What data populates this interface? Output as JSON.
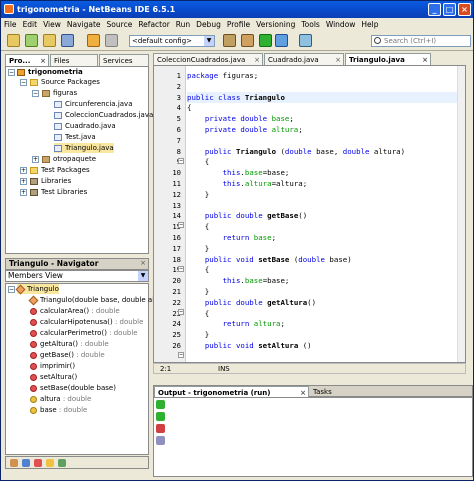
{
  "window": {
    "title": "trigonometria - NetBeans IDE 6.5.1"
  },
  "menu": [
    "File",
    "Edit",
    "View",
    "Navigate",
    "Source",
    "Refactor",
    "Run",
    "Debug",
    "Profile",
    "Versioning",
    "Tools",
    "Window",
    "Help"
  ],
  "toolbar": {
    "config": "<default config>",
    "search_placeholder": "Search (Ctrl+I)"
  },
  "left_tabs": [
    "Pro...",
    "Files",
    "Services"
  ],
  "tree": {
    "project": "trigonometria",
    "source_packages": "Source Packages",
    "package": "figuras",
    "files": [
      "Circunferencia.java",
      "ColeccionCuadrados.java",
      "Cuadrado.java",
      "Test.java",
      "Triangulo.java"
    ],
    "other_package": "otropaquete",
    "test_packages": "Test Packages",
    "libraries": "Libraries",
    "test_libraries": "Test Libraries"
  },
  "navigator": {
    "title": "Triangulo - Navigator",
    "view": "Members View",
    "root": "Triangulo",
    "members": [
      {
        "name": "Triangulo(double base, double altura)",
        "type": "",
        "kind": "constructor"
      },
      {
        "name": "calcularArea()",
        "type": " : double",
        "kind": "method"
      },
      {
        "name": "calcularHipotenusa()",
        "type": " : double",
        "kind": "method"
      },
      {
        "name": "calcularPerimetro()",
        "type": " : double",
        "kind": "method"
      },
      {
        "name": "getAltura()",
        "type": " : double",
        "kind": "method"
      },
      {
        "name": "getBase()",
        "type": " : double",
        "kind": "method"
      },
      {
        "name": "imprimir()",
        "type": "",
        "kind": "method"
      },
      {
        "name": "setAltura()",
        "type": "",
        "kind": "method"
      },
      {
        "name": "setBase(double base)",
        "type": "",
        "kind": "method"
      },
      {
        "name": "altura",
        "type": " : double",
        "kind": "field"
      },
      {
        "name": "base",
        "type": " : double",
        "kind": "field"
      }
    ]
  },
  "editor_tabs": [
    "ColeccionCuadrados.java",
    "Cuadrado.java",
    "Triangulo.java"
  ],
  "code_lines": [
    {
      "n": "1",
      "html": "<span class='kw'>package</span> figuras;"
    },
    {
      "n": "2",
      "html": ""
    },
    {
      "n": "3",
      "html": "<span class='kw'>public class</span> <span class='bold'>Triangulo</span>",
      "hl": true
    },
    {
      "n": "4",
      "html": "{"
    },
    {
      "n": "5",
      "html": "    <span class='kw'>private double</span> <span class='fld'>base</span>;"
    },
    {
      "n": "6",
      "html": "    <span class='kw'>private double</span> <span class='fld'>altura</span>;"
    },
    {
      "n": "7",
      "html": ""
    },
    {
      "n": "8",
      "html": "    <span class='kw'>public</span> <span class='bold'>Triangulo</span> (<span class='kw'>double</span> base, <span class='kw'>double</span> altura)"
    },
    {
      "n": "9",
      "html": "    {"
    },
    {
      "n": "10",
      "html": "        <span class='kw'>this</span>.<span class='fld'>base</span>=base;"
    },
    {
      "n": "11",
      "html": "        <span class='kw'>this</span>.<span class='fld'>altura</span>=altura;"
    },
    {
      "n": "12",
      "html": "    }"
    },
    {
      "n": "13",
      "html": ""
    },
    {
      "n": "14",
      "html": "    <span class='kw'>public double</span> <span class='bold'>getBase</span>()"
    },
    {
      "n": "15",
      "html": "    {"
    },
    {
      "n": "16",
      "html": "        <span class='kw'>return</span> <span class='fld'>base</span>;"
    },
    {
      "n": "17",
      "html": "    }"
    },
    {
      "n": "18",
      "html": "    <span class='kw'>public void</span> <span class='bold'>setBase</span> (<span class='kw'>double</span> base)"
    },
    {
      "n": "19",
      "html": "    {"
    },
    {
      "n": "20",
      "html": "        <span class='kw'>this</span>.<span class='fld'>base</span>=base;"
    },
    {
      "n": "21",
      "html": "    }"
    },
    {
      "n": "22",
      "html": "    <span class='kw'>public double</span> <span class='bold'>getAltura</span>()"
    },
    {
      "n": "23",
      "html": "    {"
    },
    {
      "n": "24",
      "html": "        <span class='kw'>return</span> <span class='fld'>altura</span>;"
    },
    {
      "n": "25",
      "html": "    }"
    },
    {
      "n": "26",
      "html": "    <span class='kw'>public void</span> <span class='bold'>setAltura</span> ()"
    }
  ],
  "status": {
    "position": "2:1",
    "mode": "INS"
  },
  "output": {
    "title": "Output - trigonometria (run)",
    "tasks": "Tasks"
  }
}
